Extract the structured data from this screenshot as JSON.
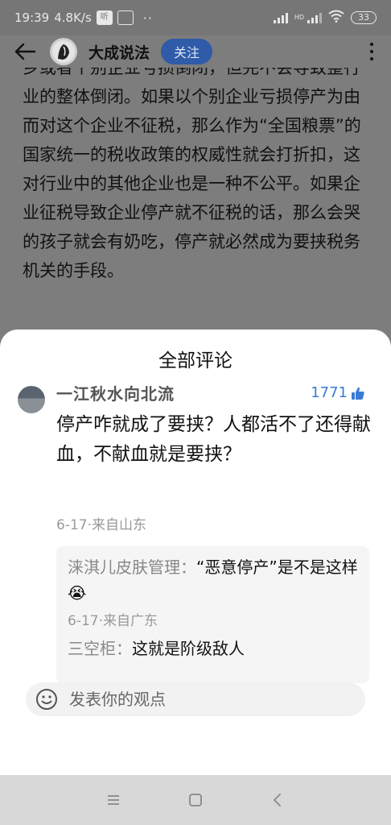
{
  "status_bar": {
    "time": "19:39",
    "speed": "4.8K/s",
    "app_badge_1": "听",
    "app_badge_2": "",
    "hd_label": "HD",
    "battery": "33"
  },
  "header": {
    "account_name": "大成说法",
    "follow_label": "关注"
  },
  "article": {
    "text": "乡或者个别企业亏损倒闭，但完不会导致整行业的整体倒闭。如果以个别企业亏损停产为由而对这个企业不征税，那么作为“全国粮票”的国家统一的税收政策的权威性就会打折扣，这对行业中的其他企业也是一种不公平。如果企业征税导致企业停产就不征税的话，那么会哭的孩子就会有奶吃，停产就必然成为要挟税务机关的手段。"
  },
  "comments_sheet": {
    "title": "全部评论",
    "comment": {
      "user": "一江秋水向北流",
      "likes": "1771",
      "text": "停产咋就成了要挟？人都活不了还得献血，不献血就是要挟？",
      "meta": "6-17·来自山东",
      "replies": [
        {
          "user": "涞淇儿皮肤管理",
          "text": "“恶意停产”是不是这样😭",
          "meta": "6-17·来自广东"
        },
        {
          "user": "三空柜",
          "text": "这就是阶级敌人"
        }
      ]
    },
    "input_placeholder": "发表你的观点"
  },
  "colors": {
    "follow_button": "#2f5ba8",
    "like_blue": "#3a7bd5"
  }
}
